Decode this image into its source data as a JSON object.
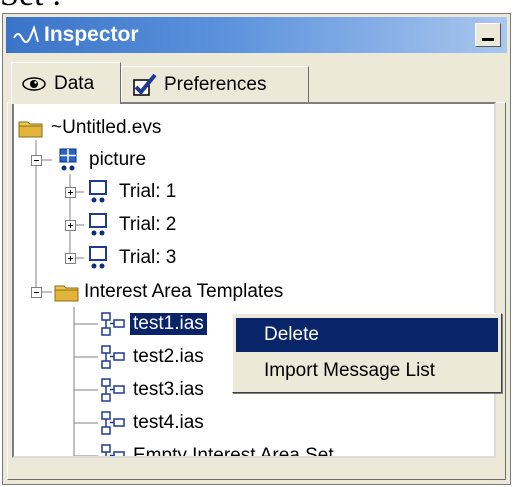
{
  "background_text": "Set :",
  "window": {
    "title": "Inspector"
  },
  "tabs": [
    {
      "label": "Data",
      "icon": "eye-icon",
      "active": true
    },
    {
      "label": "Preferences",
      "icon": "checkbox-icon",
      "active": false
    }
  ],
  "tree": {
    "root": {
      "label": "~Untitled.evs",
      "icon": "folder-icon"
    },
    "picture": {
      "label": "picture",
      "icon": "picture-node-icon"
    },
    "trials": [
      {
        "label": "Trial: 1",
        "icon": "trial-icon"
      },
      {
        "label": "Trial: 2",
        "icon": "trial-icon"
      },
      {
        "label": "Trial: 3",
        "icon": "trial-icon"
      }
    ],
    "templates": {
      "label": "Interest Area Templates",
      "icon": "folder-icon"
    },
    "template_items": [
      {
        "label": "test1.ias",
        "selected": true
      },
      {
        "label": "test2.ias",
        "selected": false
      },
      {
        "label": "test3.ias",
        "selected": false
      },
      {
        "label": "test4.ias",
        "selected": false
      },
      {
        "label": "Empty Interest Area Set",
        "selected": false
      }
    ]
  },
  "context_menu": {
    "items": [
      {
        "label": "Delete",
        "highlighted": true
      },
      {
        "label": "Import Message List",
        "highlighted": false
      }
    ]
  },
  "colors": {
    "title_gradient_start": "#3a74c8",
    "selection": "#0a246a",
    "window_face": "#ece9d8"
  }
}
